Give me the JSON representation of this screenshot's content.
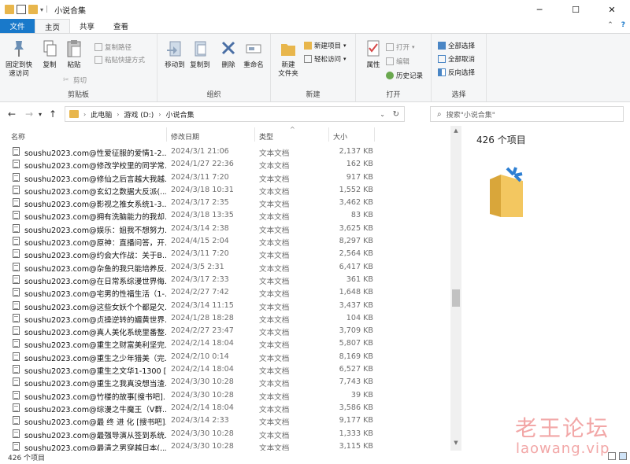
{
  "window": {
    "title": "小说合集",
    "minimize_icon": "minimize-icon",
    "maximize_icon": "maximize-icon",
    "close_icon": "close-icon"
  },
  "ribbon_tabs": [
    "文件",
    "主页",
    "共享",
    "查看"
  ],
  "ribbon": {
    "clipboard": {
      "pin_label": "固定到快\n速访问",
      "copy_label": "复制",
      "paste_label": "粘贴",
      "copy_path": "复制路径",
      "paste_shortcut": "粘贴快捷方式",
      "cut": "剪切",
      "group_label": "剪贴板"
    },
    "organize": {
      "move_to": "移动到",
      "copy_to": "复制到",
      "delete": "删除",
      "rename": "重命名",
      "group_label": "组织"
    },
    "new": {
      "new_folder": "新建\n文件夹",
      "new_item": "新建项目",
      "easy_access": "轻松访问",
      "group_label": "新建"
    },
    "open": {
      "properties": "属性",
      "open": "打开",
      "edit": "编辑",
      "history": "历史记录",
      "group_label": "打开"
    },
    "select": {
      "select_all": "全部选择",
      "select_none": "全部取消",
      "invert": "反向选择",
      "group_label": "选择"
    }
  },
  "address": {
    "segments": [
      "此电脑",
      "游戏 (D:)",
      "小说合集"
    ],
    "search_placeholder": "搜索\"小说合集\""
  },
  "columns": {
    "name": "名称",
    "date": "修改日期",
    "type": "类型",
    "size": "大小"
  },
  "files": [
    {
      "name": "soushu2023.com@性爱征服的爱情1-2...",
      "date": "2024/3/1 21:06",
      "type": "文本文档",
      "size": "2,137 KB"
    },
    {
      "name": "soushu2023.com@修改学校里的同学常...",
      "date": "2024/1/27 22:36",
      "type": "文本文档",
      "size": "162 KB"
    },
    {
      "name": "soushu2023.com@修仙之后言越大我越...",
      "date": "2024/3/11 7:20",
      "type": "文本文档",
      "size": "917 KB"
    },
    {
      "name": "soushu2023.com@玄幻之数据大反派(...",
      "date": "2024/3/18 10:31",
      "type": "文本文档",
      "size": "1,552 KB"
    },
    {
      "name": "soushu2023.com@影视之推女系统1-3...",
      "date": "2024/3/17 2:35",
      "type": "文本文档",
      "size": "3,462 KB"
    },
    {
      "name": "soushu2023.com@拥有洗脑能力的我却...",
      "date": "2024/3/18 13:35",
      "type": "文本文档",
      "size": "83 KB"
    },
    {
      "name": "soushu2023.com@娱乐：姐我不想努力...",
      "date": "2024/3/14 2:38",
      "type": "文本文档",
      "size": "3,625 KB"
    },
    {
      "name": "soushu2023.com@原神：直播问答，开...",
      "date": "2024/4/15 2:04",
      "type": "文本文档",
      "size": "8,297 KB"
    },
    {
      "name": "soushu2023.com@约会大作战：关于B...",
      "date": "2024/3/11 7:20",
      "type": "文本文档",
      "size": "2,564 KB"
    },
    {
      "name": "soushu2023.com@杂鱼的我只能培养反...",
      "date": "2024/3/5 2:31",
      "type": "文本文档",
      "size": "6,417 KB"
    },
    {
      "name": "soushu2023.com@在日常系综漫世界侮...",
      "date": "2024/3/17 2:33",
      "type": "文本文档",
      "size": "361 KB"
    },
    {
      "name": "soushu2023.com@宅男的性福生活（1-...",
      "date": "2024/2/27 7:42",
      "type": "文本文档",
      "size": "1,648 KB"
    },
    {
      "name": "soushu2023.com@这些女妖个个都是欠...",
      "date": "2024/3/14 11:15",
      "type": "文本文档",
      "size": "3,437 KB"
    },
    {
      "name": "soushu2023.com@贞操逆转的媚黄世界...",
      "date": "2024/1/28 18:28",
      "type": "文本文档",
      "size": "104 KB"
    },
    {
      "name": "soushu2023.com@真人美化系统里番整...",
      "date": "2024/2/27 23:47",
      "type": "文本文档",
      "size": "3,709 KB"
    },
    {
      "name": "soushu2023.com@重生之财富美利坚完...",
      "date": "2024/2/14 18:04",
      "type": "文本文档",
      "size": "5,807 KB"
    },
    {
      "name": "soushu2023.com@重生之少年猎美（完...",
      "date": "2024/2/10 0:14",
      "type": "文本文档",
      "size": "8,169 KB"
    },
    {
      "name": "soushu2023.com@重生之文华1-1300 [...",
      "date": "2024/2/14 18:04",
      "type": "文本文档",
      "size": "6,527 KB"
    },
    {
      "name": "soushu2023.com@重生之我真没想当渣...",
      "date": "2024/3/30 10:28",
      "type": "文本文档",
      "size": "7,743 KB"
    },
    {
      "name": "soushu2023.com@竹楼的故事[搜书吧]...",
      "date": "2024/3/30 10:28",
      "type": "文本文档",
      "size": "39 KB"
    },
    {
      "name": "soushu2023.com@综漫之牛魔王（V群...",
      "date": "2024/2/14 18:04",
      "type": "文本文档",
      "size": "3,586 KB"
    },
    {
      "name": "soushu2023.com@最 终 进 化 [搜书吧]...",
      "date": "2024/3/14 2:33",
      "type": "文本文档",
      "size": "9,177 KB"
    },
    {
      "name": "soushu2023.com@最强导演从签到系统...",
      "date": "2024/3/30 10:28",
      "type": "文本文档",
      "size": "1,333 KB"
    },
    {
      "name": "soushu2023.com@最清之男穿越日本(...",
      "date": "2024/3/30 10:28",
      "type": "文本文档",
      "size": "3,115 KB"
    }
  ],
  "details": {
    "count": "426 个项目"
  },
  "status": {
    "count": "426 个项目"
  },
  "watermark": {
    "line1": "老王论坛",
    "line2": "laowang.vip"
  }
}
